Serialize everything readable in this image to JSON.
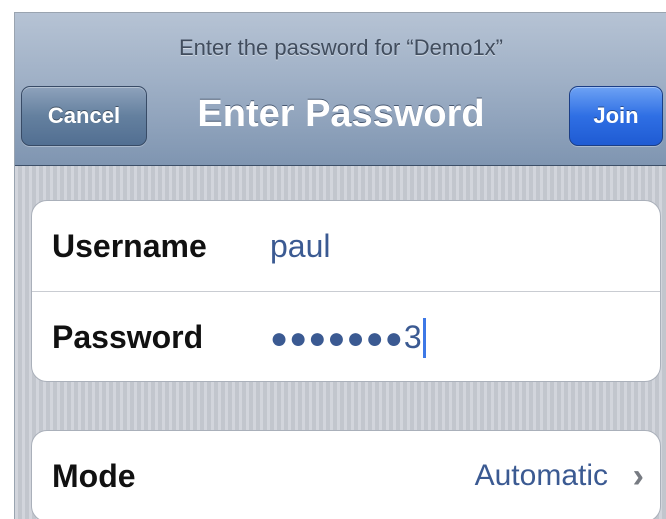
{
  "header": {
    "prompt": "Enter the password for “Demo1x”",
    "title": "Enter Password",
    "cancel_label": "Cancel",
    "join_label": "Join"
  },
  "form": {
    "username_label": "Username",
    "username_value": "paul",
    "password_label": "Password",
    "password_masked": "●●●●●●●",
    "password_last_char": "3"
  },
  "mode": {
    "label": "Mode",
    "value": "Automatic",
    "chevron": "›"
  },
  "colors": {
    "join_accent": "#2f6fe4",
    "value_text": "#3b5a92"
  },
  "icons": {
    "disclosure": "chevron-right-icon"
  }
}
